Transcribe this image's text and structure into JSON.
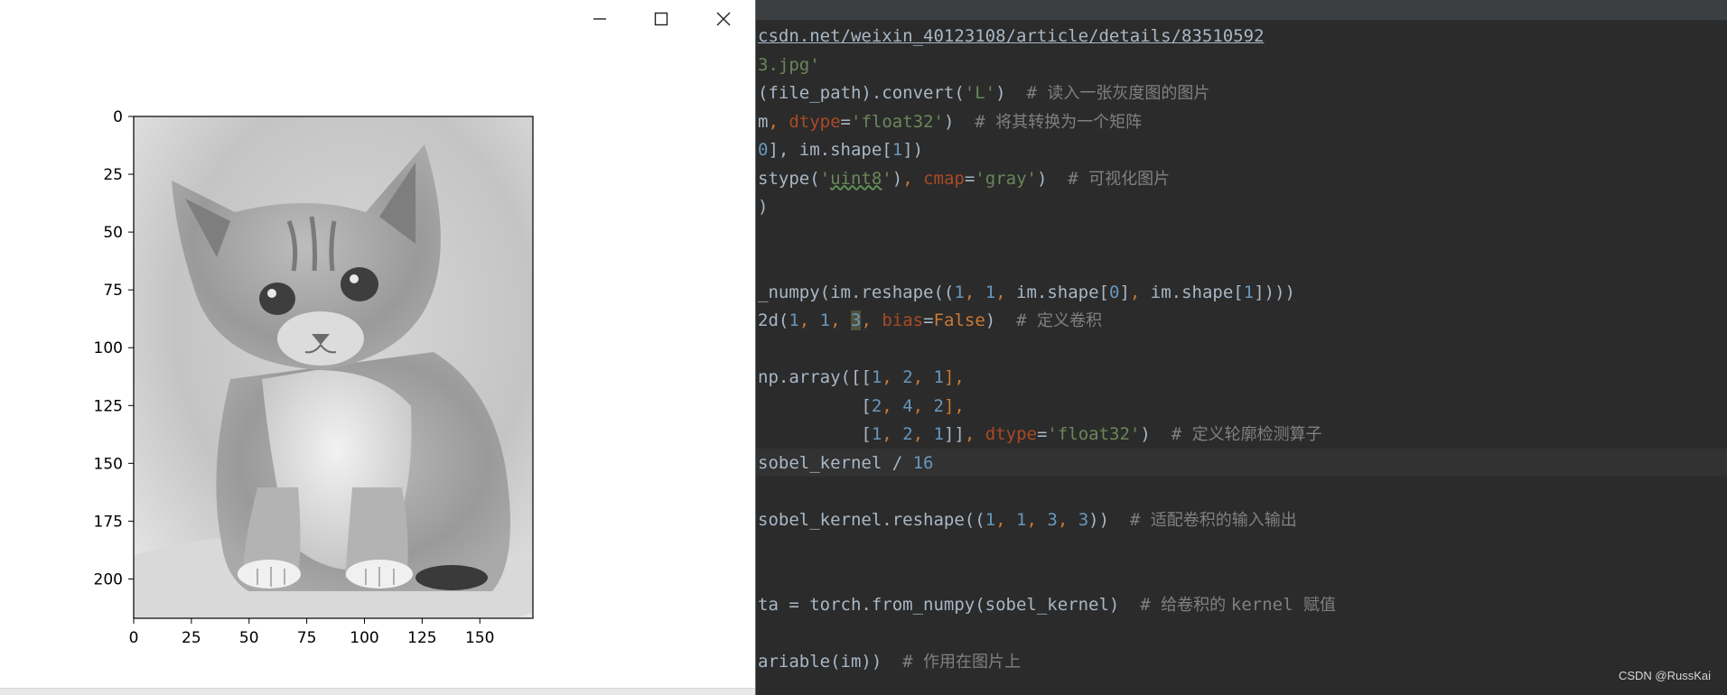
{
  "figure_window": {
    "controls": {
      "minimize_icon": "minimize-icon",
      "maximize_icon": "maximize-icon",
      "close_icon": "close-icon"
    },
    "plot": {
      "image_description_icon": "kitten-grayscale-image",
      "y_ticks": [
        "0",
        "25",
        "50",
        "75",
        "100",
        "125",
        "150",
        "175",
        "200"
      ],
      "x_ticks": [
        "0",
        "25",
        "50",
        "75",
        "100",
        "125",
        "150"
      ]
    }
  },
  "chart_data": {
    "type": "heatmap",
    "title": "",
    "xlabel": "",
    "ylabel": "",
    "colormap": "gray",
    "xlim": [
      0,
      173
    ],
    "ylim": [
      0,
      217
    ],
    "x_ticks": [
      0,
      25,
      50,
      75,
      100,
      125,
      150
    ],
    "y_ticks": [
      0,
      25,
      50,
      75,
      100,
      125,
      150,
      175,
      200
    ],
    "y_inverted": true
  },
  "editor": {
    "background": "#2b2b2b",
    "lines": [
      [
        {
          "t": "csdn.net/weixin_40123108/article/details/83510592",
          "c": "t-url"
        }
      ],
      [
        {
          "t": "3.jpg'",
          "c": "t-str"
        }
      ],
      [
        {
          "t": "(file_path).convert(",
          "c": ""
        },
        {
          "t": "'L'",
          "c": "t-str"
        },
        {
          "t": ")  ",
          "c": ""
        },
        {
          "t": "# ",
          "c": "t-cmt"
        },
        {
          "t": "读入一张灰度图的图片",
          "c": "cmt-cjk"
        }
      ],
      [
        {
          "t": "m",
          "c": ""
        },
        {
          "t": ", ",
          "c": "t-kw"
        },
        {
          "t": "dtype",
          "c": "t-arg"
        },
        {
          "t": "=",
          "c": ""
        },
        {
          "t": "'float32'",
          "c": "t-str"
        },
        {
          "t": ")  ",
          "c": ""
        },
        {
          "t": "# ",
          "c": "t-cmt"
        },
        {
          "t": "将其转换为一个矩阵",
          "c": "cmt-cjk"
        }
      ],
      [
        {
          "t": "0",
          "c": "t-num"
        },
        {
          "t": "], im.shape[",
          "c": ""
        },
        {
          "t": "1",
          "c": "t-num"
        },
        {
          "t": "])",
          "c": ""
        }
      ],
      [
        {
          "t": "stype(",
          "c": ""
        },
        {
          "t": "'",
          "c": "t-str"
        },
        {
          "t": "uint8",
          "c": "t-typo"
        },
        {
          "t": "'",
          "c": "t-str"
        },
        {
          "t": ")",
          "c": ""
        },
        {
          "t": ", ",
          "c": "t-kw"
        },
        {
          "t": "cmap",
          "c": "t-arg"
        },
        {
          "t": "=",
          "c": ""
        },
        {
          "t": "'gray'",
          "c": "t-str"
        },
        {
          "t": ")  ",
          "c": ""
        },
        {
          "t": "# ",
          "c": "t-cmt"
        },
        {
          "t": "可视化图片",
          "c": "cmt-cjk"
        }
      ],
      [
        {
          "t": ")",
          "c": ""
        }
      ],
      [],
      [],
      [
        {
          "t": "_numpy(im.reshape((",
          "c": ""
        },
        {
          "t": "1",
          "c": "t-num"
        },
        {
          "t": ", ",
          "c": "t-kw"
        },
        {
          "t": "1",
          "c": "t-num"
        },
        {
          "t": ", ",
          "c": "t-kw"
        },
        {
          "t": "im.shape[",
          "c": ""
        },
        {
          "t": "0",
          "c": "t-num"
        },
        {
          "t": "]",
          "c": ""
        },
        {
          "t": ", ",
          "c": "t-kw"
        },
        {
          "t": "im.shape[",
          "c": ""
        },
        {
          "t": "1",
          "c": "t-num"
        },
        {
          "t": "])))",
          "c": ""
        }
      ],
      [
        {
          "t": "2d(",
          "c": ""
        },
        {
          "t": "1",
          "c": "t-num"
        },
        {
          "t": ", ",
          "c": "t-kw"
        },
        {
          "t": "1",
          "c": "t-num"
        },
        {
          "t": ", ",
          "c": "t-kw"
        },
        {
          "t": "3",
          "c": "t-num t-sel"
        },
        {
          "t": ", ",
          "c": "t-kw"
        },
        {
          "t": "bias",
          "c": "t-arg"
        },
        {
          "t": "=",
          "c": ""
        },
        {
          "t": "False",
          "c": "t-kw"
        },
        {
          "t": ")  ",
          "c": ""
        },
        {
          "t": "# ",
          "c": "t-cmt"
        },
        {
          "t": "定义卷积",
          "c": "cmt-cjk"
        }
      ],
      [],
      [
        {
          "t": "np.array([[",
          "c": ""
        },
        {
          "t": "1",
          "c": "t-num"
        },
        {
          "t": ", ",
          "c": "t-kw"
        },
        {
          "t": "2",
          "c": "t-num"
        },
        {
          "t": ", ",
          "c": "t-kw"
        },
        {
          "t": "1",
          "c": "t-num"
        },
        {
          "t": "],",
          "c": "t-kw"
        }
      ],
      [
        {
          "t": "          [",
          "c": ""
        },
        {
          "t": "2",
          "c": "t-num"
        },
        {
          "t": ", ",
          "c": "t-kw"
        },
        {
          "t": "4",
          "c": "t-num"
        },
        {
          "t": ", ",
          "c": "t-kw"
        },
        {
          "t": "2",
          "c": "t-num"
        },
        {
          "t": "],",
          "c": "t-kw"
        }
      ],
      [
        {
          "t": "          [",
          "c": ""
        },
        {
          "t": "1",
          "c": "t-num"
        },
        {
          "t": ", ",
          "c": "t-kw"
        },
        {
          "t": "2",
          "c": "t-num"
        },
        {
          "t": ", ",
          "c": "t-kw"
        },
        {
          "t": "1",
          "c": "t-num"
        },
        {
          "t": "]]",
          "c": ""
        },
        {
          "t": ", ",
          "c": "t-kw"
        },
        {
          "t": "dtype",
          "c": "t-arg"
        },
        {
          "t": "=",
          "c": ""
        },
        {
          "t": "'float32'",
          "c": "t-str"
        },
        {
          "t": ")  ",
          "c": ""
        },
        {
          "t": "# ",
          "c": "t-cmt"
        },
        {
          "t": "定义轮廓检测算子",
          "c": "cmt-cjk"
        }
      ],
      [
        {
          "t": "sobel_kernel / ",
          "c": ""
        },
        {
          "t": "16",
          "c": "t-num"
        }
      ],
      [],
      [
        {
          "t": "sobel_kernel.reshape((",
          "c": ""
        },
        {
          "t": "1",
          "c": "t-num"
        },
        {
          "t": ", ",
          "c": "t-kw"
        },
        {
          "t": "1",
          "c": "t-num"
        },
        {
          "t": ", ",
          "c": "t-kw"
        },
        {
          "t": "3",
          "c": "t-num"
        },
        {
          "t": ", ",
          "c": "t-kw"
        },
        {
          "t": "3",
          "c": "t-num"
        },
        {
          "t": "))  ",
          "c": ""
        },
        {
          "t": "# ",
          "c": "t-cmt"
        },
        {
          "t": "适配卷积的输入输出",
          "c": "cmt-cjk"
        }
      ],
      [],
      [],
      [
        {
          "t": "ta = torch.from_numpy(sobel_kernel)  ",
          "c": ""
        },
        {
          "t": "# ",
          "c": "t-cmt"
        },
        {
          "t": "给卷积的 ",
          "c": "cmt-cjk"
        },
        {
          "t": "kernel ",
          "c": "t-cmt"
        },
        {
          "t": "赋值",
          "c": "cmt-cjk"
        }
      ],
      [],
      [
        {
          "t": "ariable(im))  ",
          "c": ""
        },
        {
          "t": "# ",
          "c": "t-cmt"
        },
        {
          "t": "作用在图片上",
          "c": "cmt-cjk"
        }
      ]
    ]
  },
  "watermark": "CSDN @RussKai"
}
